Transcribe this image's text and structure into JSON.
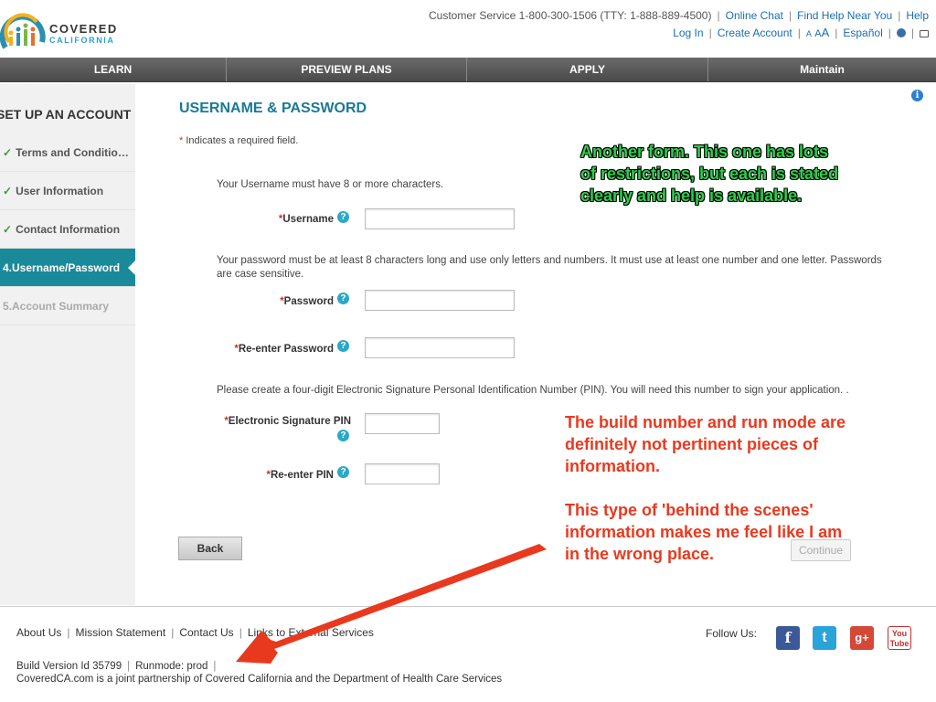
{
  "brand": {
    "line1": "COVERED",
    "line2": "CALIFORNIA"
  },
  "utility": {
    "customer_service": "Customer Service 1-800-300-1506 (TTY: 1-888-889-4500)",
    "online_chat": "Online Chat",
    "find_help": "Find Help Near You",
    "help": "Help",
    "log_in": "Log In",
    "create_account": "Create Account",
    "text_size_small": "A",
    "text_size_medium": "A",
    "text_size_large": "A",
    "espanol": "Español"
  },
  "nav": {
    "items": [
      {
        "label": "LEARN"
      },
      {
        "label": "PREVIEW PLANS"
      },
      {
        "label": "APPLY"
      },
      {
        "label": "Maintain"
      }
    ]
  },
  "sidebar": {
    "title": "SET UP AN ACCOUNT",
    "items": [
      {
        "label": "Terms and Conditio…",
        "status": "complete"
      },
      {
        "label": "User Information",
        "status": "complete"
      },
      {
        "label": "Contact Information",
        "status": "complete"
      },
      {
        "label": "4.Username/Password",
        "status": "active"
      },
      {
        "label": "5.Account Summary",
        "status": "disabled"
      }
    ]
  },
  "form": {
    "title": "USERNAME & PASSWORD",
    "required_note": "Indicates a required field.",
    "username_instruction": "Your Username must have 8 or more characters.",
    "username_label": "Username",
    "password_instruction": "Your password must be at least 8 characters long and use only letters and numbers. It must use at least one number and one letter. Passwords are case sensitive.",
    "password_label": "Password",
    "reenter_password_label": "Re-enter Password",
    "pin_instruction": "Please create a four-digit Electronic Signature Personal Identification Number (PIN). You will need this number to sign your application. .",
    "pin_label": "Electronic Signature PIN",
    "reenter_pin_label": "Re-enter PIN",
    "back_button": "Back",
    "continue_button": "Continue"
  },
  "annotations": {
    "green_note": "Another form.  This one has lots of restrictions, but each is stated clearly and help is available.",
    "red_note_1": "The build number and run mode are definitely not pertinent pieces of information.",
    "red_note_2": "This type of 'behind the scenes' information makes me feel like I am in the wrong place."
  },
  "footer": {
    "about_us": "About Us",
    "mission_statement": "Mission Statement",
    "contact_us": "Contact Us",
    "links_external": "Links to External Services",
    "follow_us": "Follow Us:",
    "build_version": "Build Version Id 35799",
    "runmode": "Runmode: prod",
    "partnership": "CoveredCA.com is a joint partnership of Covered California and the Department of Health Care Services"
  },
  "colors": {
    "accent_teal": "#1a7a96",
    "active_step": "#1a8a9a",
    "annotation_green": "#2bd14a",
    "annotation_red": "#e8391f"
  }
}
